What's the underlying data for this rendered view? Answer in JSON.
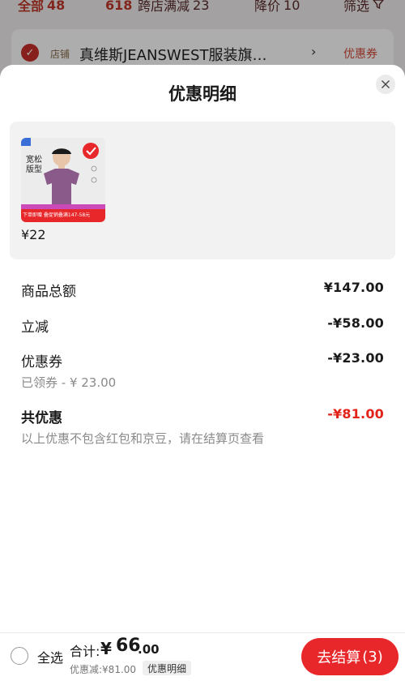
{
  "background": {
    "tabs": [
      {
        "label": "全部",
        "count": "48"
      },
      {
        "label": "618",
        "count": ""
      },
      {
        "label": "跨店满减",
        "count": "23"
      },
      {
        "label": "降价",
        "count": "10"
      },
      {
        "label": "筛选",
        "count": ""
      }
    ],
    "store": {
      "tag": "店铺",
      "name": "真维斯JEANSWEST服装旗…",
      "arrow": "›",
      "coupon": "优惠券"
    }
  },
  "sheet": {
    "title": "优惠明细",
    "close_icon": "close-icon",
    "product": {
      "badge_line1": "宽松",
      "badge_line2": "版型",
      "banner_text": "下单即赠 叠促销叠满147-58元",
      "price": "¥22"
    },
    "rows": {
      "goods_total_label": "商品总额",
      "goods_total_value": "¥147.00",
      "instant_label": "立减",
      "instant_value": "-¥58.00",
      "coupon_label": "优惠券",
      "coupon_value": "-¥23.00",
      "coupon_note": "已领券 - ¥ 23.00",
      "total_label": "共优惠",
      "total_value": "-¥81.00",
      "total_note": "以上优惠不包含红包和京豆，请在结算页查看"
    }
  },
  "bottom_bar": {
    "select_all_label": "全选",
    "sum_label": "合计:",
    "sum_yen": "¥",
    "sum_int": "66",
    "sum_dec": ".00",
    "discount_line": "优惠减:¥81.00",
    "detail_pill": "优惠明细",
    "checkout_label": "去结算",
    "checkout_count": "(3)"
  },
  "colors": {
    "accent_red": "#e2231a",
    "checkout_red": "#e8272b"
  }
}
